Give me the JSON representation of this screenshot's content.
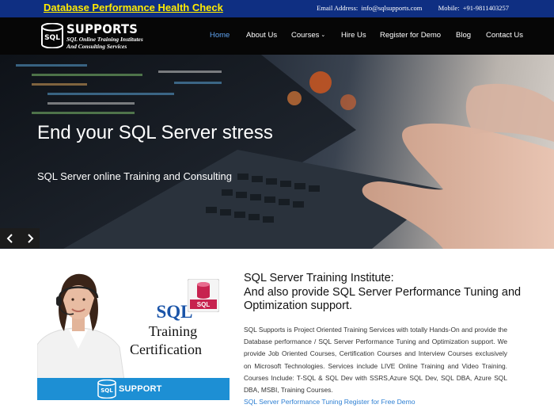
{
  "topbar": {
    "promo": "Database Performance Health Check",
    "email_label": "Email Address:",
    "email": "info@sqlsupports.com",
    "mobile_label": "Mobile:",
    "mobile": "+91-9811403257",
    "bg_color": "#0f2f82",
    "promo_color": "#ffeb00"
  },
  "brand": {
    "name": "SUPPORTS",
    "db_label": "SQL",
    "tagline_1": "SQL Online Training Institutes",
    "tagline_2": "And Consulting Services"
  },
  "nav": {
    "items": [
      {
        "label": "Home",
        "active": true
      },
      {
        "label": "About Us"
      },
      {
        "label": "Courses",
        "has_dropdown": true
      },
      {
        "label": "Hire Us"
      },
      {
        "label": "Register for Demo"
      },
      {
        "label": "Blog"
      },
      {
        "label": "Contact Us"
      }
    ],
    "dropdown_icon": "chevron-down-icon",
    "active_color": "#5fa3f0"
  },
  "hero": {
    "title": "End your SQL Server stress",
    "subtitle": "SQL Server online Training and Consulting",
    "prev_icon": "chevron-left-icon",
    "next_icon": "chevron-right-icon"
  },
  "promo_card": {
    "sql": "SQL",
    "training": "Training",
    "certification": "Certification",
    "badge_label": "SUPPORT",
    "badge_db_label": "SQL",
    "icon_label": "SQL"
  },
  "content": {
    "title_1": "SQL Server Training Institute:",
    "title_2": "And also provide SQL Server Performance Tuning and Optimization support.",
    "body": "SQL Supports is Project Oriented Training Services with totally Hands-On and provide the Database performance / SQL Server Performance Tuning and Optimization support. We provide Job Oriented Courses, Certification Courses and Interview Courses exclusively on Microsoft Technologies. Services include LIVE Online Training and Video Training. Courses Include: T-SQL & SQL Dev with SSRS,Azure SQL Dev, SQL DBA, Azure SQL DBA, MSBI, Training Courses.",
    "link": "SQL Server Performance Tuning Register for Free Demo",
    "link_color": "#2d7fd3"
  }
}
